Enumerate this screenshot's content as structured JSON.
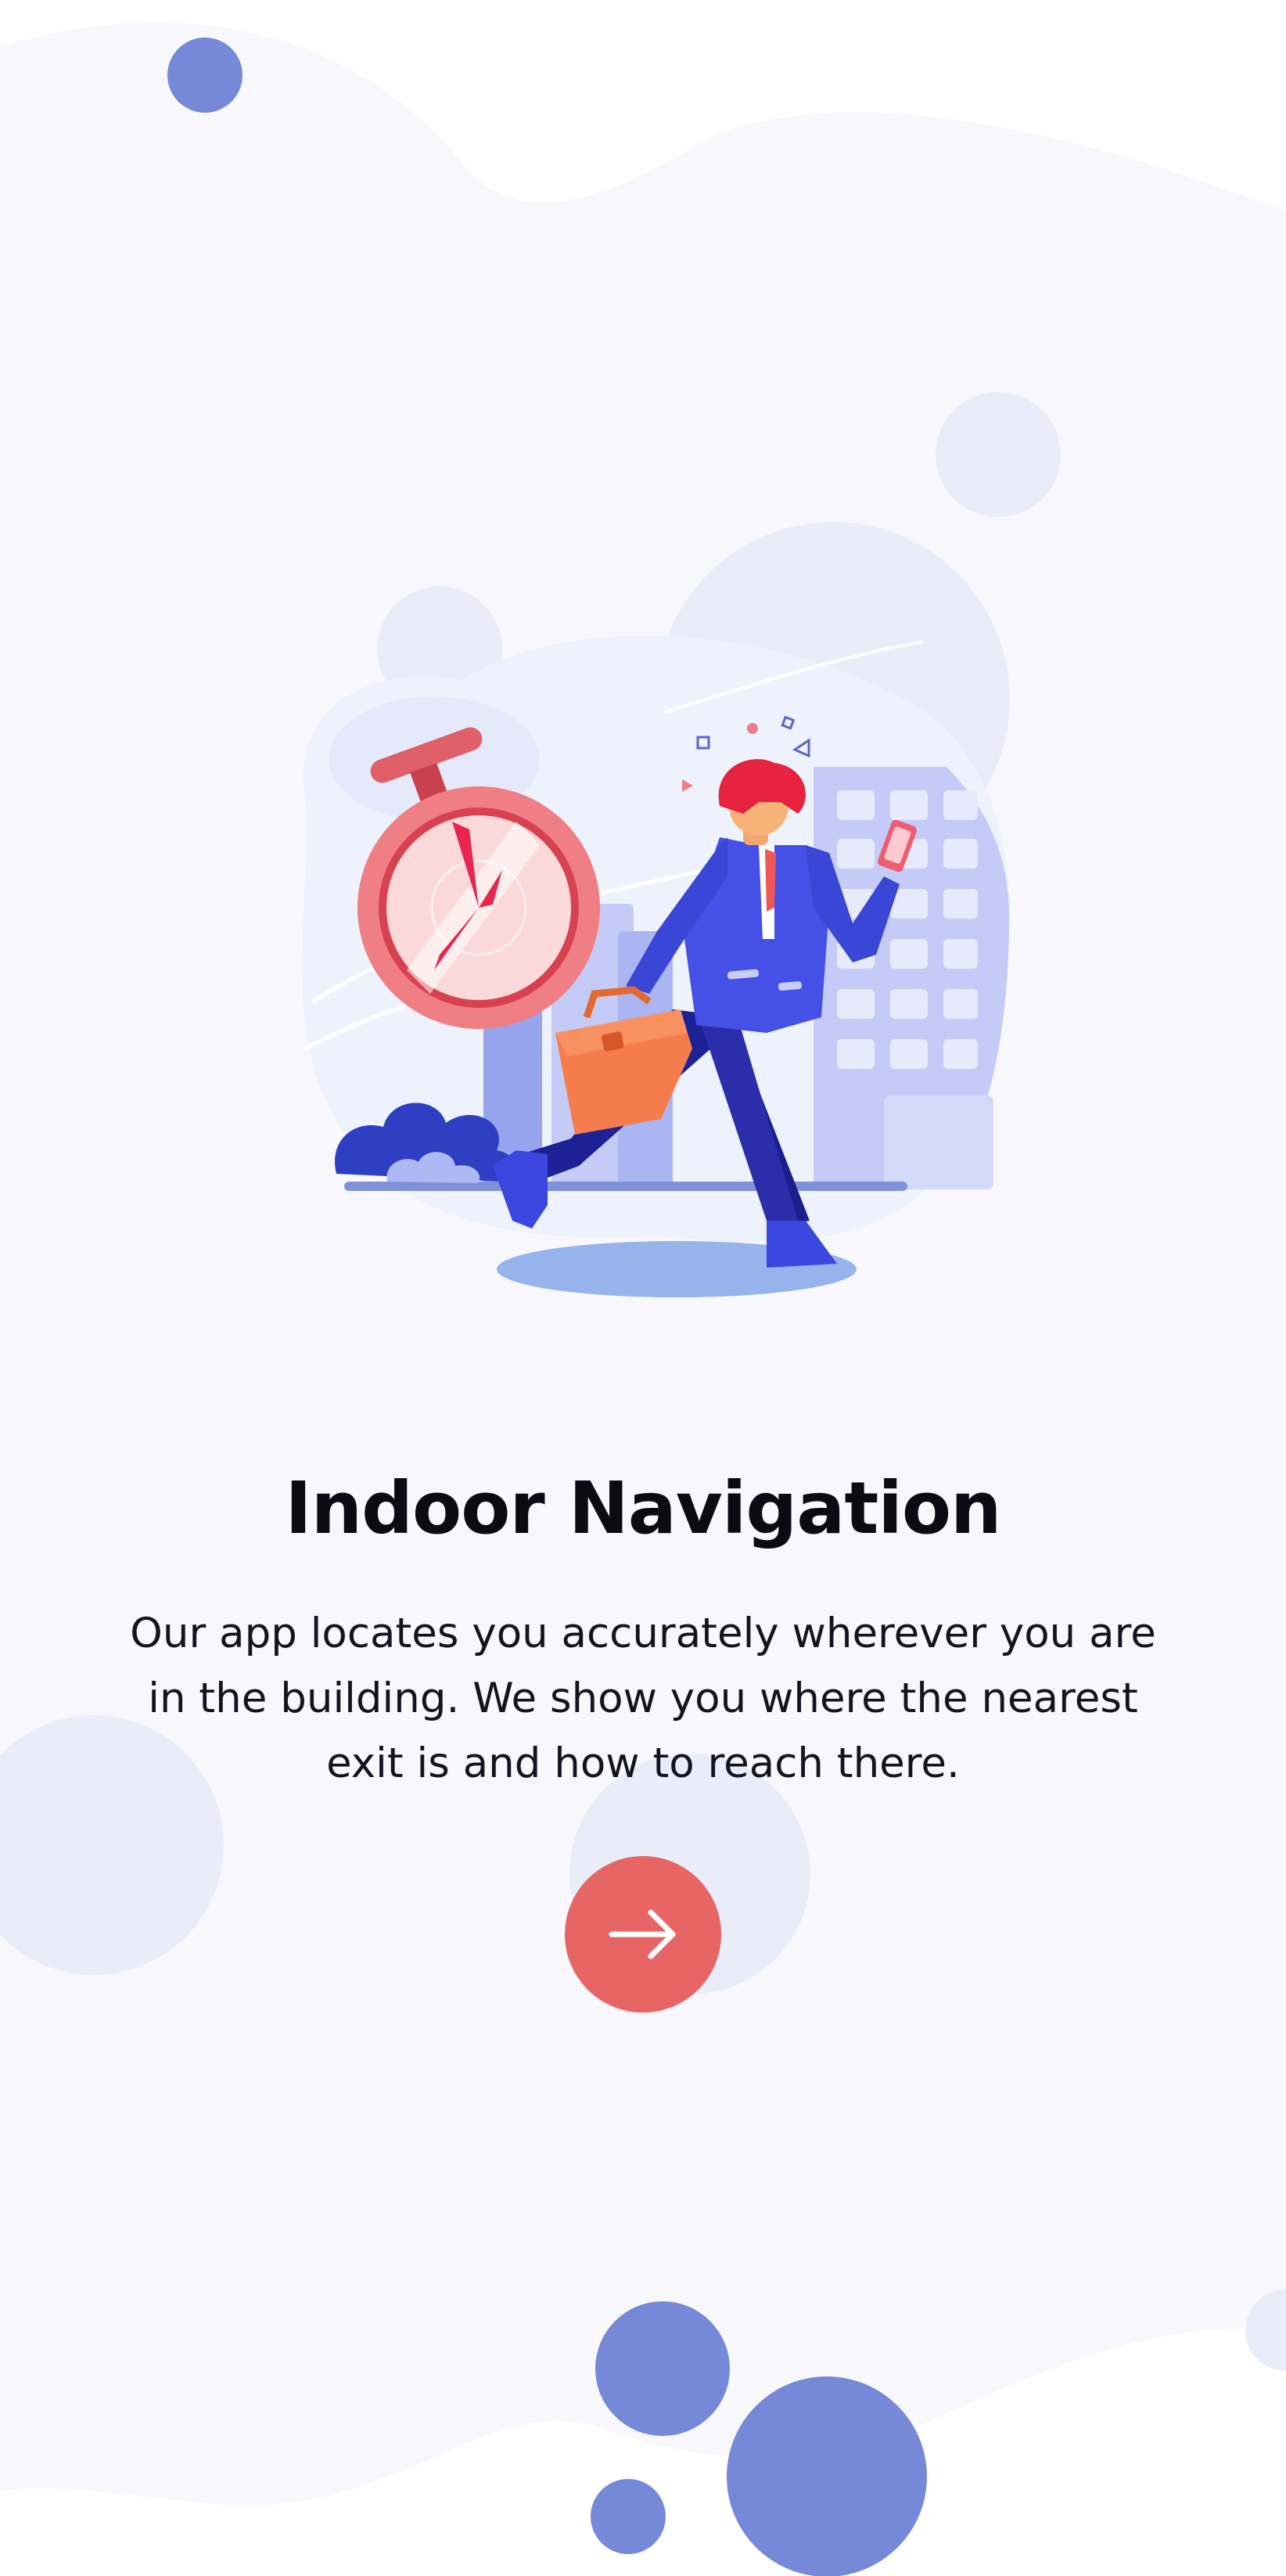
{
  "onboarding": {
    "title": "Indoor Navigation",
    "description": "Our app locates you accurately wherever you are in the building. We show you where the nearest exit is and how to reach there.",
    "next_button_icon": "arrow-right-icon"
  },
  "colors": {
    "background": "#f8f8fc",
    "blob": "#e9edf9",
    "accent_circle": "#7589d8",
    "button": "#e86565",
    "title_text": "#0b0b14"
  },
  "illustration": {
    "subject": "businessman-running-with-briefcase-and-stopwatch"
  }
}
